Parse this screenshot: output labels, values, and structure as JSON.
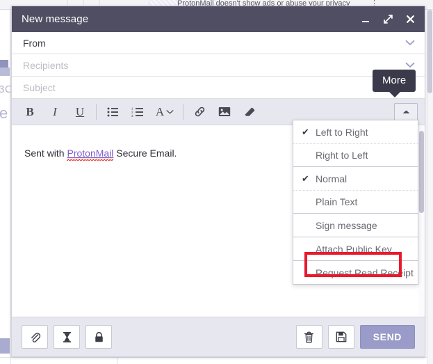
{
  "background": {
    "tagline": "ProtonMail doesn't show ads or abuse your privacy",
    "kebab_glyph": "⋮",
    "left_number": "3C",
    "left_letter": "e"
  },
  "composer": {
    "title": "New message",
    "window_controls": [
      {
        "name": "minimize",
        "label": "Minimize"
      },
      {
        "name": "expand",
        "label": "Expand"
      },
      {
        "name": "close",
        "label": "Close"
      }
    ],
    "fields": {
      "from": {
        "label": "From",
        "value": "From",
        "is_placeholder": false
      },
      "recipients": {
        "label": "Recipients",
        "placeholder": "Recipients",
        "value": "",
        "is_placeholder": true
      },
      "subject": {
        "label": "Subject",
        "placeholder": "Subject",
        "value": "",
        "is_placeholder": true
      }
    },
    "format_toolbar": {
      "items": [
        {
          "name": "bold",
          "glyph": "B"
        },
        {
          "name": "italic",
          "glyph": "I"
        },
        {
          "name": "underline",
          "glyph": "U"
        },
        {
          "name": "unordered-list",
          "glyph": "☰"
        },
        {
          "name": "ordered-list",
          "glyph": "≡"
        },
        {
          "name": "font",
          "glyph": "A"
        },
        {
          "name": "link",
          "glyph": "ὑ7"
        },
        {
          "name": "image",
          "glyph": "ὛB"
        },
        {
          "name": "clear-formatting",
          "glyph": "▰"
        }
      ],
      "more_button_label": "More",
      "more_tooltip": "More"
    },
    "body": {
      "prefix": "Sent with ",
      "link_text": "ProtonMail",
      "suffix": " Secure Email."
    },
    "bottom_toolbar": {
      "attach_label": "Attachment",
      "expiration_label": "Expiration time",
      "encryption_label": "Encryption",
      "discard_label": "Discard",
      "save_label": "Save draft",
      "send_label": "SEND"
    }
  },
  "more_menu": {
    "groups": [
      {
        "items": [
          {
            "label": "Left to Right",
            "checked": true
          },
          {
            "label": "Right to Left",
            "checked": false
          }
        ]
      },
      {
        "items": [
          {
            "label": "Normal",
            "checked": true
          },
          {
            "label": "Plain Text",
            "checked": false
          }
        ]
      },
      {
        "items": [
          {
            "label": "Sign message",
            "checked": false
          }
        ]
      },
      {
        "items": [
          {
            "label": "Attach Public Key",
            "checked": false
          }
        ]
      },
      {
        "items": [
          {
            "label": "Request Read Receipt",
            "checked": false
          }
        ]
      }
    ],
    "check_glyph": "✔",
    "highlighted_item": "Attach Public Key"
  },
  "colors": {
    "titlebar": "#4f4e62",
    "toolbar": "#e6e7ef",
    "send_button": "#9a9bc8",
    "annotation": "#e8192c",
    "link": "#7b5ecb",
    "tooltip": "#3a3a4b"
  }
}
